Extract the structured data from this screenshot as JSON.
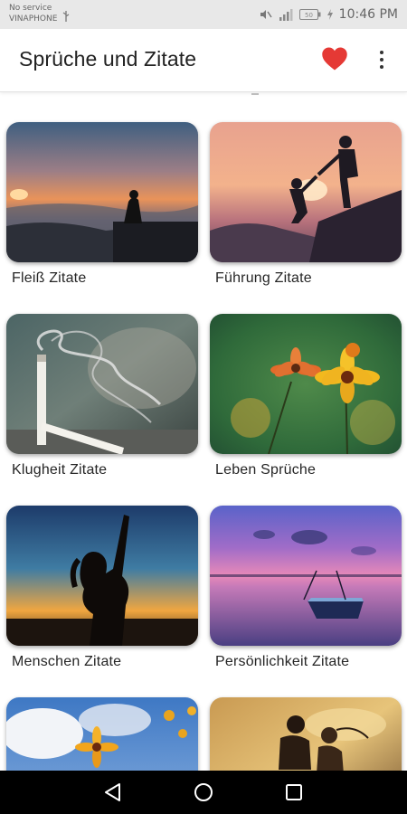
{
  "status_bar": {
    "carrier_line1": "No service",
    "carrier_line2": "VINAPHONE",
    "time": "10:46 PM",
    "icons": [
      "usb-icon",
      "mute-icon",
      "signal-icon",
      "battery-icon",
      "charging-icon"
    ]
  },
  "app_bar": {
    "title": "Sprüche und Zitate",
    "favorite_icon": "heart-icon",
    "favorite_color": "#e53935",
    "menu_icon": "more-vert-icon"
  },
  "categories": [
    {
      "label": "Fleiß Zitate"
    },
    {
      "label": "Führung Zitate"
    },
    {
      "label": "Klugheit Zitate"
    },
    {
      "label": "Leben Sprüche"
    },
    {
      "label": "Menschen Zitate"
    },
    {
      "label": "Persönlichkeit Zitate"
    },
    {
      "label": ""
    },
    {
      "label": ""
    }
  ],
  "nav_bar": {
    "back_icon": "back-triangle-icon",
    "home_icon": "home-circle-icon",
    "recents_icon": "recents-square-icon"
  }
}
